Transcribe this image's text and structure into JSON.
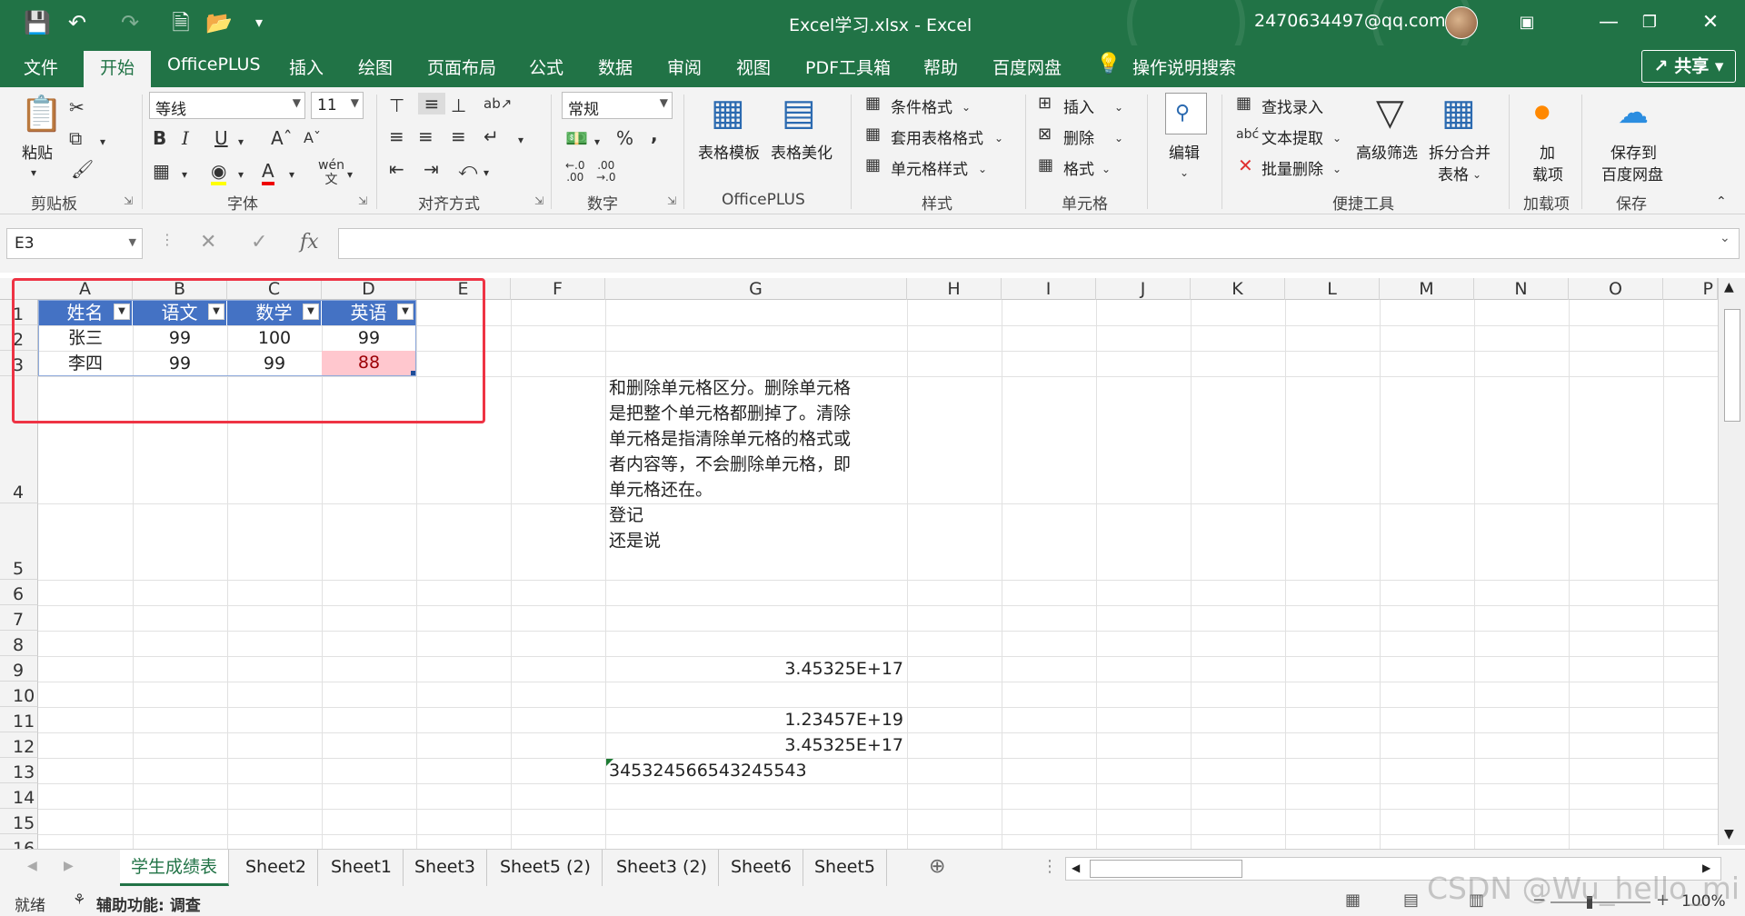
{
  "window": {
    "title": "Excel学习.xlsx  -  Excel",
    "account": "2470634497@qq.com"
  },
  "tabs": [
    "文件",
    "开始",
    "OfficePLUS",
    "插入",
    "绘图",
    "页面布局",
    "公式",
    "数据",
    "审阅",
    "视图",
    "PDF工具箱",
    "帮助",
    "百度网盘",
    "操作说明搜索"
  ],
  "share_label": "共享",
  "ribbon": {
    "clipboard": {
      "paste": "粘贴",
      "group": "剪贴板"
    },
    "font": {
      "name": "等线",
      "size": "11",
      "bold": "B",
      "italic": "I",
      "underline": "U",
      "group": "字体"
    },
    "alignment": {
      "group": "对齐方式"
    },
    "number": {
      "format": "常规",
      "percent": "%",
      "comma": ",",
      "group": "数字"
    },
    "officeplus": {
      "template": "表格模板",
      "beautify": "表格美化",
      "group": "OfficePLUS"
    },
    "styles": {
      "conditional": "条件格式",
      "table_format": "套用表格格式",
      "cell_style": "单元格样式",
      "group": "样式"
    },
    "cells": {
      "insert": "插入",
      "delete": "删除",
      "format": "格式",
      "group": "单元格"
    },
    "editing": {
      "label": "编辑"
    },
    "tools": {
      "find": "查找录入",
      "extract": "文本提取",
      "batch_delete": "批量删除",
      "filter": "高级筛选",
      "split_merge_1": "拆分合并",
      "split_merge_2": "表格",
      "group": "便捷工具"
    },
    "addins": {
      "line1": "加",
      "line2": "载项",
      "group": "加载项"
    },
    "save": {
      "line1": "保存到",
      "line2": "百度网盘",
      "group": "保存"
    }
  },
  "formula_bar": {
    "name_box": "E3",
    "formula": ""
  },
  "columns": [
    "A",
    "B",
    "C",
    "D",
    "E",
    "F",
    "G",
    "H",
    "I",
    "J",
    "K",
    "L",
    "M",
    "N",
    "O",
    "P"
  ],
  "rows": [
    "1",
    "2",
    "3",
    "4",
    "5",
    "6",
    "7",
    "8",
    "9",
    "10",
    "11",
    "12",
    "13",
    "14",
    "15",
    "16"
  ],
  "table": {
    "headers": [
      "姓名",
      "语文",
      "数学",
      "英语"
    ],
    "rows": [
      [
        "张三",
        "99",
        "100",
        "99"
      ],
      [
        "李四",
        "99",
        "99",
        "88"
      ]
    ]
  },
  "notes": {
    "g4_lines": [
      "和删除单元格区分。删除单元格",
      "是把整个单元格都删掉了。清除",
      "单元格是指清除单元格的格式或",
      "者内容等，不会删除单元格，即",
      "单元格还在。"
    ],
    "g5_lines": [
      "登记",
      "还是说"
    ],
    "g9": "3.45325E+17",
    "g11": "1.23457E+19",
    "g12": "3.45325E+17",
    "g13": "345324566543245543"
  },
  "sheets": [
    "学生成绩表",
    "Sheet2",
    "Sheet1",
    "Sheet3",
    "Sheet5 (2)",
    "Sheet3 (2)",
    "Sheet6",
    "Sheet5"
  ],
  "status": {
    "ready": "就绪",
    "accessibility": "辅助功能: 调查",
    "zoom": "100%"
  },
  "watermark": "CSDN @Wu_hello_mi",
  "colors": {
    "excel_green": "#217346",
    "table_header": "#4472c4",
    "highlight_cell": "#ffc7ce",
    "highlight_text": "#9c0006",
    "selection_box": "#ee3344"
  }
}
